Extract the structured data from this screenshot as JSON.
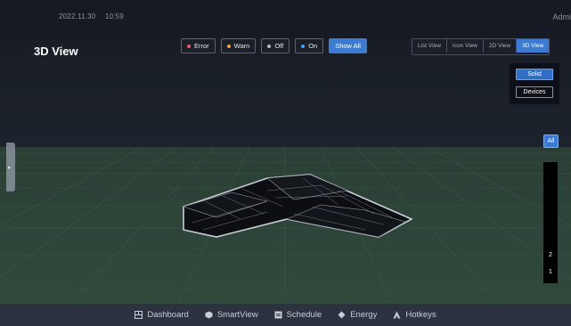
{
  "header": {
    "date": "2022.11.30",
    "time": "10:59",
    "user": "Admi"
  },
  "page": {
    "title": "3D View"
  },
  "filters": [
    {
      "label": "Error",
      "color": "#f0555a"
    },
    {
      "label": "Warn",
      "color": "#f5a623"
    },
    {
      "label": "Off",
      "color": "#b8bec8"
    },
    {
      "label": "On",
      "color": "#4aa3ff"
    }
  ],
  "show_all_label": "Show All",
  "view_tabs": [
    "List View",
    "Icon View",
    "2D View",
    "3D View"
  ],
  "active_view": "3D View",
  "mode_panel": {
    "solid": "Solid",
    "devices": "Devices"
  },
  "floor_selector": {
    "all_label": "All",
    "floors": [
      "2",
      "1"
    ]
  },
  "bottom_nav": [
    {
      "label": "Dashboard",
      "icon": "dashboard-icon"
    },
    {
      "label": "SmartView",
      "icon": "smartview-icon"
    },
    {
      "label": "Schedule",
      "icon": "schedule-icon"
    },
    {
      "label": "Energy",
      "icon": "energy-icon"
    },
    {
      "label": "Hotkeys",
      "icon": "hotkeys-icon"
    }
  ],
  "colors": {
    "accent": "#3a7bd5",
    "ground": "#2e4a3c",
    "background": "#181c24"
  }
}
